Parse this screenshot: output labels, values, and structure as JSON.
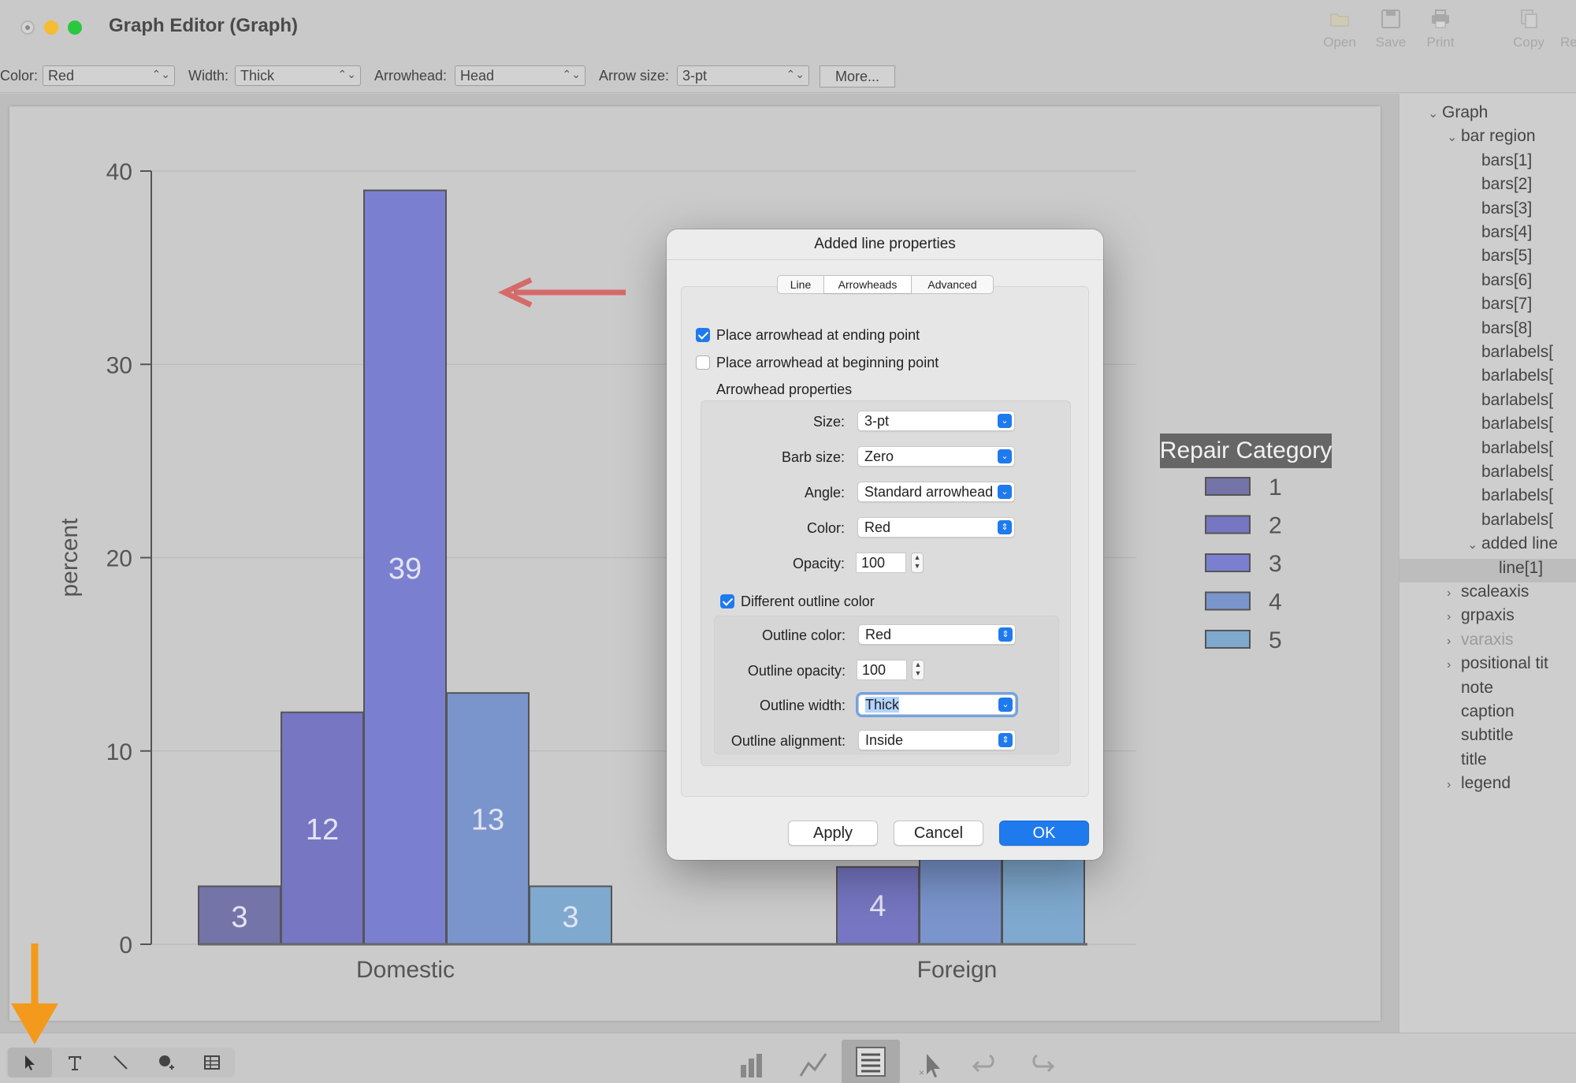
{
  "window": {
    "title": "Graph Editor (Graph)"
  },
  "toolbar": {
    "tools": [
      {
        "label": "Open",
        "icon": "folder-icon"
      },
      {
        "label": "Save",
        "icon": "save-icon"
      },
      {
        "label": "Print",
        "icon": "print-icon"
      },
      {
        "label": "Copy",
        "icon": "copy-icon"
      },
      {
        "label": "Re",
        "icon": "redo-icon"
      }
    ]
  },
  "propbar": {
    "color_label": "Color:",
    "color_value": "Red",
    "width_label": "Width:",
    "width_value": "Thick",
    "arrowhead_label": "Arrowhead:",
    "arrowhead_value": "Head",
    "arrowsize_label": "Arrow size:",
    "arrowsize_value": "3-pt",
    "more_label": "More..."
  },
  "chart_data": {
    "type": "bar",
    "categories": [
      "Domestic",
      "Foreign"
    ],
    "series": [
      {
        "name": "1",
        "values": [
          3,
          null
        ],
        "color": "#7474a8"
      },
      {
        "name": "2",
        "values": [
          12,
          4
        ],
        "color": "#7676c2"
      },
      {
        "name": "3",
        "values": [
          39,
          null
        ],
        "color": "#7a80cf"
      },
      {
        "name": "4",
        "values": [
          13,
          null
        ],
        "color": "#7a95cc"
      },
      {
        "name": "5",
        "values": [
          3,
          null
        ],
        "color": "#7fa9cf"
      }
    ],
    "bar_labels": [
      "3",
      "12",
      "39",
      "13",
      "3",
      "4"
    ],
    "ylabel": "percent",
    "ylim": [
      0,
      40
    ],
    "yticks": [
      "0",
      "10",
      "20",
      "30",
      "40"
    ],
    "grid": true,
    "legend": {
      "title": "Repair Category",
      "placement": "right",
      "items": [
        "1",
        "2",
        "3",
        "4",
        "5"
      ]
    },
    "annotation": {
      "type": "added line",
      "color": "#d66a6a",
      "arrowhead": "ending point"
    }
  },
  "browser": {
    "items": [
      {
        "label": "Graph",
        "chev": "⌄",
        "level": 0
      },
      {
        "label": "bar region",
        "chev": "⌄",
        "level": 1
      },
      {
        "label": "bars[1]",
        "chev": "",
        "level": 2
      },
      {
        "label": "bars[2]",
        "chev": "",
        "level": 2
      },
      {
        "label": "bars[3]",
        "chev": "",
        "level": 2
      },
      {
        "label": "bars[4]",
        "chev": "",
        "level": 2
      },
      {
        "label": "bars[5]",
        "chev": "",
        "level": 2
      },
      {
        "label": "bars[6]",
        "chev": "",
        "level": 2
      },
      {
        "label": "bars[7]",
        "chev": "",
        "level": 2
      },
      {
        "label": "bars[8]",
        "chev": "",
        "level": 2
      },
      {
        "label": "barlabels[",
        "chev": "",
        "level": 2
      },
      {
        "label": "barlabels[",
        "chev": "",
        "level": 2
      },
      {
        "label": "barlabels[",
        "chev": "",
        "level": 2
      },
      {
        "label": "barlabels[",
        "chev": "",
        "level": 2
      },
      {
        "label": "barlabels[",
        "chev": "",
        "level": 2
      },
      {
        "label": "barlabels[",
        "chev": "",
        "level": 2
      },
      {
        "label": "barlabels[",
        "chev": "",
        "level": 2
      },
      {
        "label": "barlabels[",
        "chev": "",
        "level": 2
      },
      {
        "label": "added line",
        "chev": "⌄",
        "level": 2
      },
      {
        "label": "line[1]",
        "chev": "",
        "level": 3,
        "selected": true
      },
      {
        "label": "scaleaxis",
        "chev": "›",
        "level": 1
      },
      {
        "label": "grpaxis",
        "chev": "›",
        "level": 1
      },
      {
        "label": "varaxis",
        "chev": "›",
        "level": 1,
        "dim": true
      },
      {
        "label": "positional tit",
        "chev": "›",
        "level": 1
      },
      {
        "label": "note",
        "chev": "",
        "level": 1
      },
      {
        "label": "caption",
        "chev": "",
        "level": 1
      },
      {
        "label": "subtitle",
        "chev": "",
        "level": 1
      },
      {
        "label": "title",
        "chev": "",
        "level": 1
      },
      {
        "label": "legend",
        "chev": "›",
        "level": 1
      }
    ]
  },
  "dialog": {
    "title": "Added line properties",
    "tabs": [
      "Line",
      "Arrowheads",
      "Advanced"
    ],
    "active_tab": "Arrowheads",
    "cb_end": "Place arrowhead at ending point",
    "cb_begin": "Place arrowhead at beginning point",
    "section": "Arrowhead properties",
    "size_label": "Size:",
    "size_value": "3-pt",
    "barb_label": "Barb size:",
    "barb_value": "Zero",
    "angle_label": "Angle:",
    "angle_value": "Standard arrowhead",
    "color_label": "Color:",
    "color_value": "Red",
    "opacity_label": "Opacity:",
    "opacity_value": "100",
    "cb_outline": "Different outline color",
    "outline_color_label": "Outline color:",
    "outline_color_value": "Red",
    "outline_opacity_label": "Outline opacity:",
    "outline_opacity_value": "100",
    "outline_width_label": "Outline width:",
    "outline_width_value": "Thick",
    "outline_align_label": "Outline alignment:",
    "outline_align_value": "Inside",
    "apply_label": "Apply",
    "cancel_label": "Cancel",
    "ok_label": "OK"
  },
  "colors": {
    "accent": "#1f7aee",
    "annotation_orange": "#f39a1d"
  }
}
